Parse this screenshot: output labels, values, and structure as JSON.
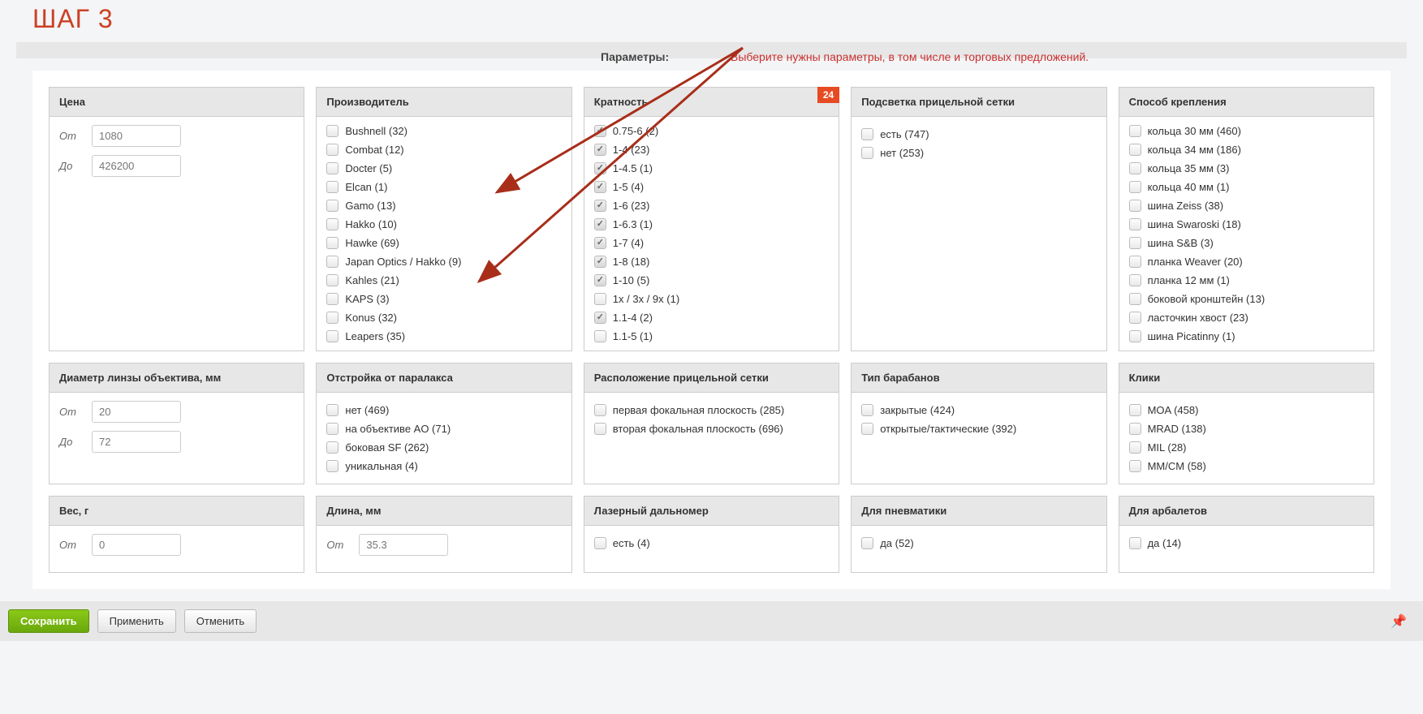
{
  "step_title": "ШАГ 3",
  "param_label": "Параметры:",
  "param_hint": "Выберите нужны параметры, в том числе и торговых предложений.",
  "price": {
    "title": "Цена",
    "from_label": "От",
    "to_label": "До",
    "from_ph": "1080",
    "to_ph": "426200"
  },
  "manufacturer": {
    "title": "Производитель",
    "items": [
      {
        "label": "Bushnell (32)",
        "checked": false
      },
      {
        "label": "Combat (12)",
        "checked": false
      },
      {
        "label": "Docter (5)",
        "checked": false
      },
      {
        "label": "Elcan (1)",
        "checked": false
      },
      {
        "label": "Gamo (13)",
        "checked": false
      },
      {
        "label": "Hakko (10)",
        "checked": false
      },
      {
        "label": "Hawke (69)",
        "checked": false
      },
      {
        "label": "Japan Optics / Hakko (9)",
        "checked": false
      },
      {
        "label": "Kahles (21)",
        "checked": false
      },
      {
        "label": "KAPS (3)",
        "checked": false
      },
      {
        "label": "Konus (32)",
        "checked": false
      },
      {
        "label": "Leapers (35)",
        "checked": false
      }
    ]
  },
  "magnification": {
    "title": "Кратность",
    "badge": "24",
    "items": [
      {
        "label": "0.75-6 (2)",
        "checked": true
      },
      {
        "label": "1-4 (23)",
        "checked": true
      },
      {
        "label": "1-4.5 (1)",
        "checked": true
      },
      {
        "label": "1-5 (4)",
        "checked": true
      },
      {
        "label": "1-6 (23)",
        "checked": true
      },
      {
        "label": "1-6.3 (1)",
        "checked": true
      },
      {
        "label": "1-7 (4)",
        "checked": true
      },
      {
        "label": "1-8 (18)",
        "checked": true
      },
      {
        "label": "1-10 (5)",
        "checked": true
      },
      {
        "label": "1x / 3x / 9x (1)",
        "checked": false
      },
      {
        "label": "1.1-4 (2)",
        "checked": true
      },
      {
        "label": "1.1-5 (1)",
        "checked": false
      }
    ]
  },
  "reticle_light": {
    "title": "Подсветка прицельной сетки",
    "items": [
      {
        "label": "есть (747)",
        "checked": false
      },
      {
        "label": "нет (253)",
        "checked": false
      }
    ]
  },
  "mount": {
    "title": "Способ крепления",
    "items": [
      {
        "label": "кольца 30 мм (460)",
        "checked": false
      },
      {
        "label": "кольца 34 мм (186)",
        "checked": false
      },
      {
        "label": "кольца 35 мм (3)",
        "checked": false
      },
      {
        "label": "кольца 40 мм (1)",
        "checked": false
      },
      {
        "label": "шина Zeiss (38)",
        "checked": false
      },
      {
        "label": "шина Swaroski (18)",
        "checked": false
      },
      {
        "label": "шина S&B (3)",
        "checked": false
      },
      {
        "label": "планка Weaver (20)",
        "checked": false
      },
      {
        "label": "планка 12 мм (1)",
        "checked": false
      },
      {
        "label": "боковой кронштейн (13)",
        "checked": false
      },
      {
        "label": "ласточкин хвост (23)",
        "checked": false
      },
      {
        "label": "шина Picatinny (1)",
        "checked": false
      }
    ]
  },
  "lens_diameter": {
    "title": "Диаметр линзы объектива, мм",
    "from_label": "От",
    "to_label": "До",
    "from_ph": "20",
    "to_ph": "72"
  },
  "parallax": {
    "title": "Отстройка от паралакса",
    "items": [
      {
        "label": "нет (469)",
        "checked": false
      },
      {
        "label": "на объективе AO (71)",
        "checked": false
      },
      {
        "label": "боковая SF (262)",
        "checked": false
      },
      {
        "label": "уникальная (4)",
        "checked": false
      }
    ]
  },
  "reticle_pos": {
    "title": "Расположение прицельной сетки",
    "items": [
      {
        "label": "первая фокальная плоскость (285)",
        "checked": false
      },
      {
        "label": "вторая фокальная плоскость (696)",
        "checked": false
      }
    ]
  },
  "turrets": {
    "title": "Тип барабанов",
    "items": [
      {
        "label": "закрытые (424)",
        "checked": false
      },
      {
        "label": "открытые/тактические (392)",
        "checked": false
      }
    ]
  },
  "clicks": {
    "title": "Клики",
    "items": [
      {
        "label": "MOA (458)",
        "checked": false
      },
      {
        "label": "MRAD (138)",
        "checked": false
      },
      {
        "label": "MIL (28)",
        "checked": false
      },
      {
        "label": "MM/CM (58)",
        "checked": false
      }
    ]
  },
  "weight": {
    "title": "Вес, г",
    "from_label": "От",
    "from_ph": "0"
  },
  "length": {
    "title": "Длина, мм",
    "from_label": "От",
    "from_ph": "35.3"
  },
  "rangefinder": {
    "title": "Лазерный дальномер",
    "items": [
      {
        "label": "есть (4)",
        "checked": false
      }
    ]
  },
  "pneumatic": {
    "title": "Для пневматики",
    "items": [
      {
        "label": "да (52)",
        "checked": false
      }
    ]
  },
  "crossbow": {
    "title": "Для арбалетов",
    "items": [
      {
        "label": "да (14)",
        "checked": false
      }
    ]
  },
  "buttons": {
    "save": "Сохранить",
    "apply": "Применить",
    "cancel": "Отменить"
  }
}
